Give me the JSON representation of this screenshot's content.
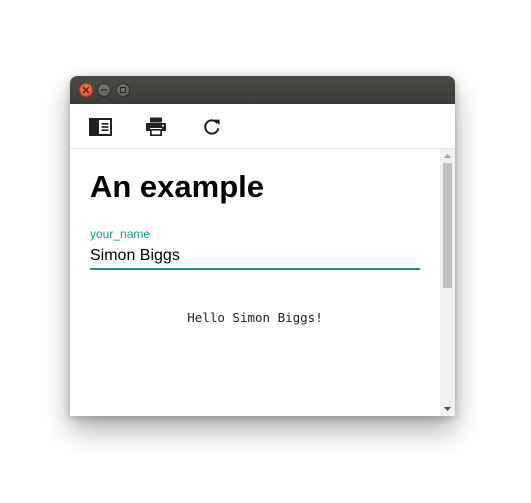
{
  "window": {
    "controls": [
      "close",
      "minimize",
      "maximize"
    ]
  },
  "toolbar": {
    "buttons": [
      {
        "icon": "sidebar-toggle-icon"
      },
      {
        "icon": "print-icon"
      },
      {
        "icon": "refresh-icon"
      }
    ]
  },
  "page": {
    "heading": "An example",
    "input": {
      "label": "your_name",
      "value": "Simon Biggs"
    },
    "output_text": "Hello Simon Biggs!"
  },
  "colors": {
    "accent": "#139c94",
    "titlebar": "#3d3c38",
    "close_button": "#e0542a"
  }
}
